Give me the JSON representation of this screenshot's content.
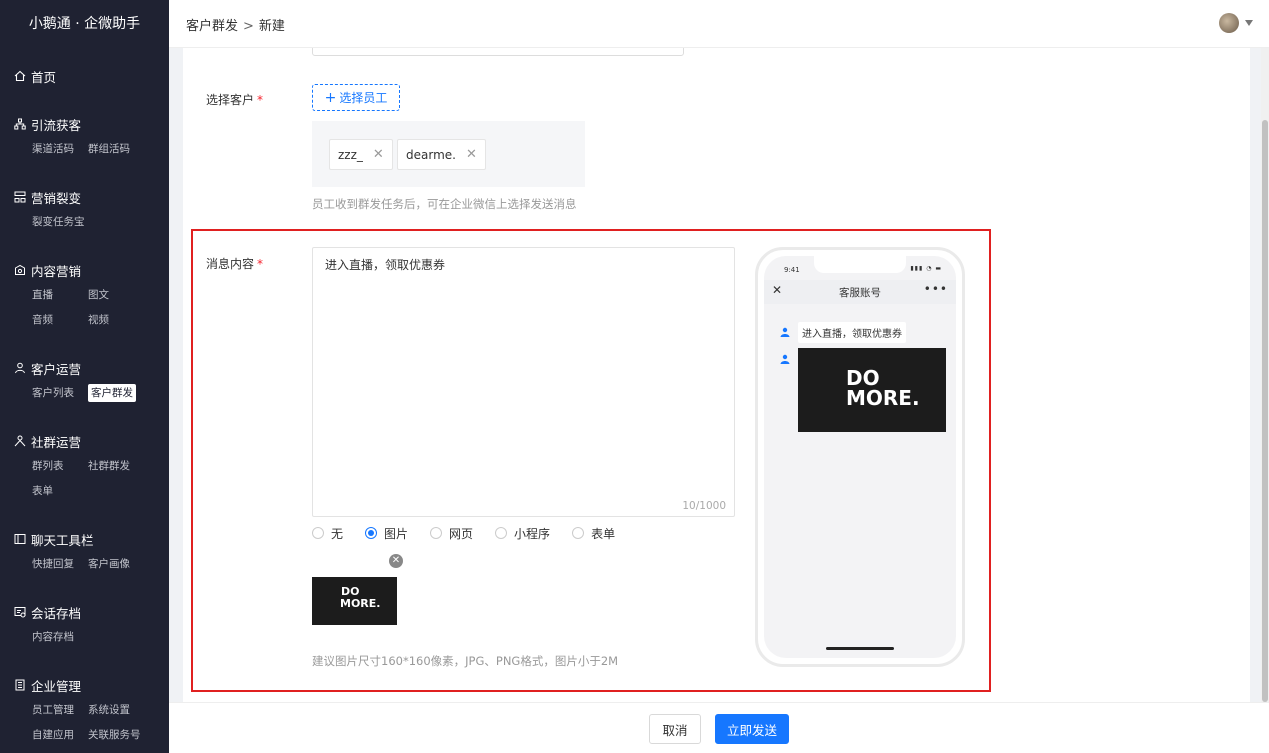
{
  "app": {
    "brand": "小鹅通 · 企微助手"
  },
  "header": {
    "breadcrumb_parent": "客户群发",
    "breadcrumb_sep": ">",
    "breadcrumb_current": "新建"
  },
  "sidebar": {
    "home": "首页",
    "groups": [
      {
        "title": "引流获客",
        "items": [
          "渠道活码",
          "群组活码"
        ]
      },
      {
        "title": "营销裂变",
        "items": [
          "裂变任务宝"
        ]
      },
      {
        "title": "内容营销",
        "items": [
          "直播",
          "图文",
          "音频",
          "视频"
        ]
      },
      {
        "title": "客户运营",
        "items": [
          "客户列表",
          "客户群发"
        ]
      },
      {
        "title": "社群运营",
        "items": [
          "群列表",
          "社群群发",
          "表单"
        ]
      },
      {
        "title": "聊天工具栏",
        "items": [
          "快捷回复",
          "客户画像"
        ]
      },
      {
        "title": "会话存档",
        "items": [
          "内容存档"
        ]
      },
      {
        "title": "企业管理",
        "items": [
          "员工管理",
          "系统设置",
          "自建应用",
          "关联服务号"
        ]
      }
    ],
    "active_item": "客户群发"
  },
  "form": {
    "select_customer_label": "选择客户",
    "select_staff_button": "选择员工",
    "selected_tags": [
      "zzz_",
      "dearme."
    ],
    "staff_hint": "员工收到群发任务后，可在企业微信上选择发送消息",
    "message_label": "消息内容",
    "message_text": "进入直播，领取优惠券",
    "char_count": "10/1000",
    "attachment_types": [
      "无",
      "图片",
      "网页",
      "小程序",
      "表单"
    ],
    "selected_attachment": "图片",
    "image_text_line1": "DO",
    "image_text_line2": "MORE.",
    "image_hint": "建议图片尺寸160*160像素，JPG、PNG格式，图片小于2M"
  },
  "preview": {
    "time": "9:41",
    "status_icons": "▮▮▮ ◔ ▬",
    "title": "客服账号",
    "message_text": "进入直播，领取优惠券",
    "image_text_line1": "DO",
    "image_text_line2": "MORE."
  },
  "footer": {
    "cancel": "取消",
    "send": "立即发送"
  },
  "colors": {
    "primary": "#1677ff",
    "sidebar_bg": "#1f2232",
    "required": "#f5222d",
    "highlight_frame": "#e02020"
  }
}
